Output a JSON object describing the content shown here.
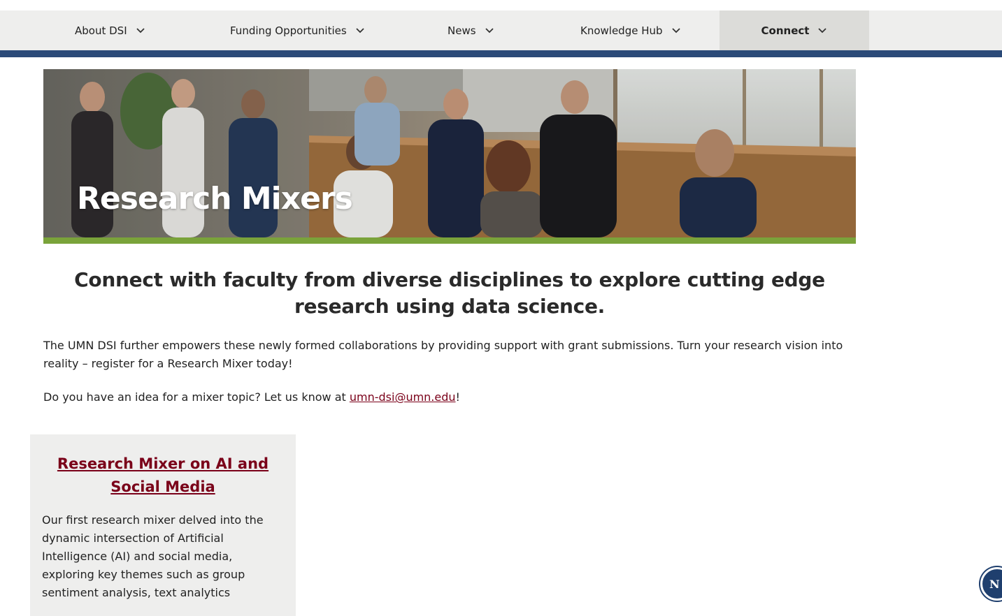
{
  "nav": {
    "items": [
      {
        "label": "About DSI"
      },
      {
        "label": "Funding Opportunities"
      },
      {
        "label": "News"
      },
      {
        "label": "Knowledge Hub"
      },
      {
        "label": "Connect"
      }
    ],
    "active_item": "Connect",
    "bar_color": "#2b4a78"
  },
  "hero": {
    "title": "Research Mixers",
    "stripe_color": "#7aa33a"
  },
  "main": {
    "tagline": "Connect with faculty from diverse disciplines to explore cutting edge research using data science.",
    "paragraph1": "The UMN DSI further empowers these newly formed collaborations by providing support with grant submissions. Turn your research vision into reality – register for a Research Mixer today!",
    "paragraph2_prefix": "Do you have an idea for a mixer topic? Let us know at ",
    "contact_email": "umn-dsi@umn.edu",
    "paragraph2_suffix": "!"
  },
  "card": {
    "title": "Research Mixer on AI and Social Media",
    "text": "Our first research mixer delved into the dynamic intersection of Artificial Intelligence (AI) and social media, exploring key themes such as group sentiment analysis, text analytics"
  },
  "float_button": {
    "label": "N"
  },
  "colors": {
    "link": "#7a0019",
    "card_bg": "#eeeeed"
  }
}
